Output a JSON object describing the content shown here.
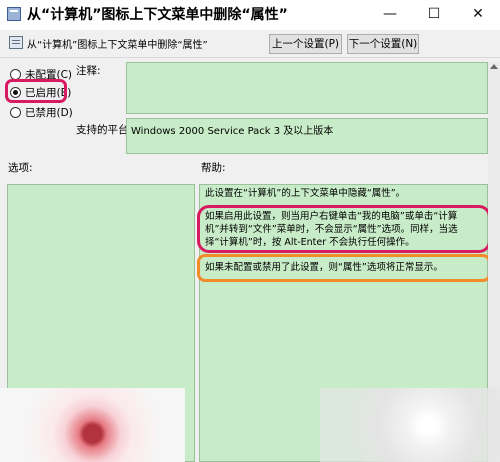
{
  "window": {
    "title": "从“计算机”图标上下文菜单中删除“属性”",
    "min_glyph": "—",
    "max_glyph": "☐",
    "close_glyph": "✕"
  },
  "header": {
    "setting_name": "从“计算机”图标上下文菜单中删除“属性”",
    "prev_button": "上一个设置(P)",
    "next_button": "下一个设置(N)"
  },
  "state": {
    "options": [
      "未配置(C)",
      "已启用(E)",
      "已禁用(D)"
    ],
    "selected": "已启用(E)"
  },
  "labels": {
    "comment": "注释:",
    "platform": "支持的平台:",
    "options": "选项:",
    "help": "帮助:"
  },
  "platform_value": "Windows 2000 Service Pack 3 及以上版本",
  "help_text": [
    "此设置在“计算机”的上下文菜单中隐藏“属性”。",
    "如果启用此设置，则当用户右键单击“我的电脑”或单击“计算机”并转到“文件”菜单时，不会显示“属性”选项。同样，当选择“计算机”时，按 Alt-Enter 不会执行任何操作。",
    "如果未配置或禁用了此设置，则“属性”选项将正常显示。"
  ],
  "colors": {
    "panel_green": "#c8ecc8",
    "highlight_pink": "#d81b60",
    "highlight_orange": "#f28c28"
  },
  "icons": [
    "policy-icon",
    "setting-icon",
    "minimize-icon",
    "maximize-icon",
    "close-icon"
  ]
}
